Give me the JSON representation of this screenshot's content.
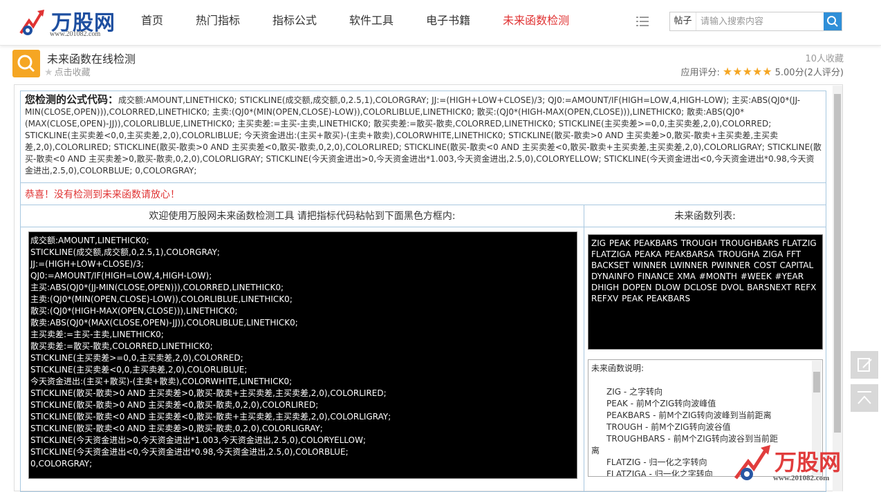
{
  "header": {
    "logo_text": "万股网",
    "logo_url": "www.201082.com",
    "nav": [
      {
        "label": "首页",
        "active": false
      },
      {
        "label": "热门指标",
        "active": false
      },
      {
        "label": "指标公式",
        "active": false
      },
      {
        "label": "软件工具",
        "active": false
      },
      {
        "label": "电子书籍",
        "active": false
      },
      {
        "label": "未来函数检测",
        "active": true
      }
    ],
    "search": {
      "category": "帖子",
      "placeholder": "请输入搜索内容",
      "icon": "search-icon"
    }
  },
  "titlebar": {
    "title": "未来函数在线检测",
    "favorite_label": "点击收藏",
    "favorite_count": "10人收藏",
    "rating_label": "应用评分:",
    "rating_stars": 5,
    "rating_score": "5.00分(2人评分)"
  },
  "result": {
    "formula_label": "您检测的公式代码：",
    "formula_text": "成交额:AMOUNT,LINETHICK0; STICKLINE(成交额,成交额,0,2.5,1),COLORGRAY; JJ:=(HIGH+LOW+CLOSE)/3; QJ0:=AMOUNT/IF(HIGH=LOW,4,HIGH-LOW); 主买:ABS(QJ0*(JJ-MIN(CLOSE,OPEN))),COLORRED,LINETHICK0; 主卖:(QJ0*(MIN(OPEN,CLOSE)-LOW)),COLORLIBLUE,LINETHICK0; 散买:(QJ0*(HIGH-MAX(OPEN,CLOSE))),LINETHICK0; 散卖:ABS(QJ0*(MAX(CLOSE,OPEN)-JJ)),COLORLIBLUE,LINETHICK0; 主买卖差:=主买-主卖,LINETHICK0; 散买卖差:=散买-散卖,COLORRED,LINETHICK0; STICKLINE(主买卖差>=0,0,主买卖差,2,0),COLORRED; STICKLINE(主买卖差<0,0,主买卖差,2,0),COLORLIBLUE; 今天资金进出:(主买+散买)-(主卖+散卖),COLORWHITE,LINETHICK0; STICKLINE(散买-散卖>0 AND 主买卖差>0,散买-散卖+主买卖差,主买卖差,2,0),COLORLIRED; STICKLINE(散买-散卖>0 AND 主买卖差<0,散买-散卖,0,2,0),COLORLIRED; STICKLINE(散买-散卖<0 AND 主买卖差<0,散买-散卖+主买卖差,主买卖差,2,0),COLORLIGRAY; STICKLINE(散买-散卖<0 AND 主买卖差>0,散买-散卖,0,2,0),COLORLIGRAY; STICKLINE(今天资金进出>0,今天资金进出*1.003,今天资金进出,2.5,0),COLORYELLOW; STICKLINE(今天资金进出<0,今天资金进出*0.98,今天资金进出,2.5,0),COLORBLUE; 0,COLORGRAY;",
    "notice": "恭喜！没有检测到未来函数请放心！"
  },
  "tool": {
    "left_header": "欢迎使用万股网未来函数检测工具 请把指标代码粘帖到下面黑色方框内:",
    "right_header": "未来函数列表:",
    "code_lines": [
      "成交额:AMOUNT,LINETHICK0;",
      "STICKLINE(成交额,成交额,0,2.5,1),COLORGRAY;",
      "JJ:=(HIGH+LOW+CLOSE)/3;",
      "QJ0:=AMOUNT/IF(HIGH=LOW,4,HIGH-LOW);",
      "主买:ABS(QJ0*(JJ-MIN(CLOSE,OPEN))),COLORRED,LINETHICK0;",
      "主卖:(QJ0*(MIN(OPEN,CLOSE)-LOW)),COLORLIBLUE,LINETHICK0;",
      "散买:(QJ0*(HIGH-MAX(OPEN,CLOSE))),LINETHICK0;",
      "散卖:ABS(QJ0*(MAX(CLOSE,OPEN)-JJ)),COLORLIBLUE,LINETHICK0;",
      "主买卖差:=主买-主卖,LINETHICK0;",
      "散买卖差:=散买-散卖,COLORRED,LINETHICK0;",
      "STICKLINE(主买卖差>=0,0,主买卖差,2,0),COLORRED;",
      "STICKLINE(主买卖差<0,0,主买卖差,2,0),COLORLIBLUE;",
      "今天资金进出:(主买+散买)-(主卖+散卖),COLORWHITE,LINETHICK0;",
      "STICKLINE(散买-散卖>0 AND 主买卖差>0,散买-散卖+主买卖差,主买卖差,2,0),COLORLIRED;",
      "STICKLINE(散买-散卖>0 AND 主买卖差<0,散买-散卖,0,2,0),COLORLIRED;",
      "STICKLINE(散买-散卖<0 AND 主买卖差<0,散买-散卖+主买卖差,主买卖差,2,0),COLORLIGRAY;",
      "STICKLINE(散买-散卖<0 AND 主买卖差>0,散买-散卖,0,2,0),COLORLIGRAY;",
      "STICKLINE(今天资金进出>0,今天资金进出*1.003,今天资金进出,2.5,0),COLORYELLOW;",
      "STICKLINE(今天资金进出<0,今天资金进出*0.98,今天资金进出,2.5,0),COLORBLUE;",
      "0,COLORGRAY;"
    ],
    "future_functions": "ZIG PEAK PEAKBARS TROUGH TROUGHBARS FLATZIG FLATZIGA PEAKA PEAKBARSA TROUGHA ZIGA FFT BACKSET WINNER LWINNER PWINNER COST CAPITAL DYNAINFO FINANCE XMA #MONTH #WEEK #YEAR DHIGH DOPEN DLOW DCLOSE DVOL BARSNEXT REFX REFXV PEAK PEAKBARS",
    "desc_title": "未来函数说明:",
    "desc_items": [
      "ZIG - 之字转向",
      "PEAK - 前M个ZIG转向波峰值",
      "PEAKBARS - 前M个ZIG转向波峰到当前距离",
      "TROUGH - 前M个ZIG转向波谷值",
      "TROUGHBARS - 前M个ZIG转向波谷到当前距",
      "离",
      "FLATZIG - 归一化之字转向",
      "FLATZIGA - 归一化之字转向"
    ]
  },
  "watermark": {
    "text": "万股网",
    "url": "www.201082.com"
  },
  "colors": {
    "accent": "#e03333",
    "brand_blue": "#1e4fa0",
    "search_blue": "#2f8fd8",
    "icon_orange": "#f5a623",
    "border_blue": "#a8c8e0"
  }
}
